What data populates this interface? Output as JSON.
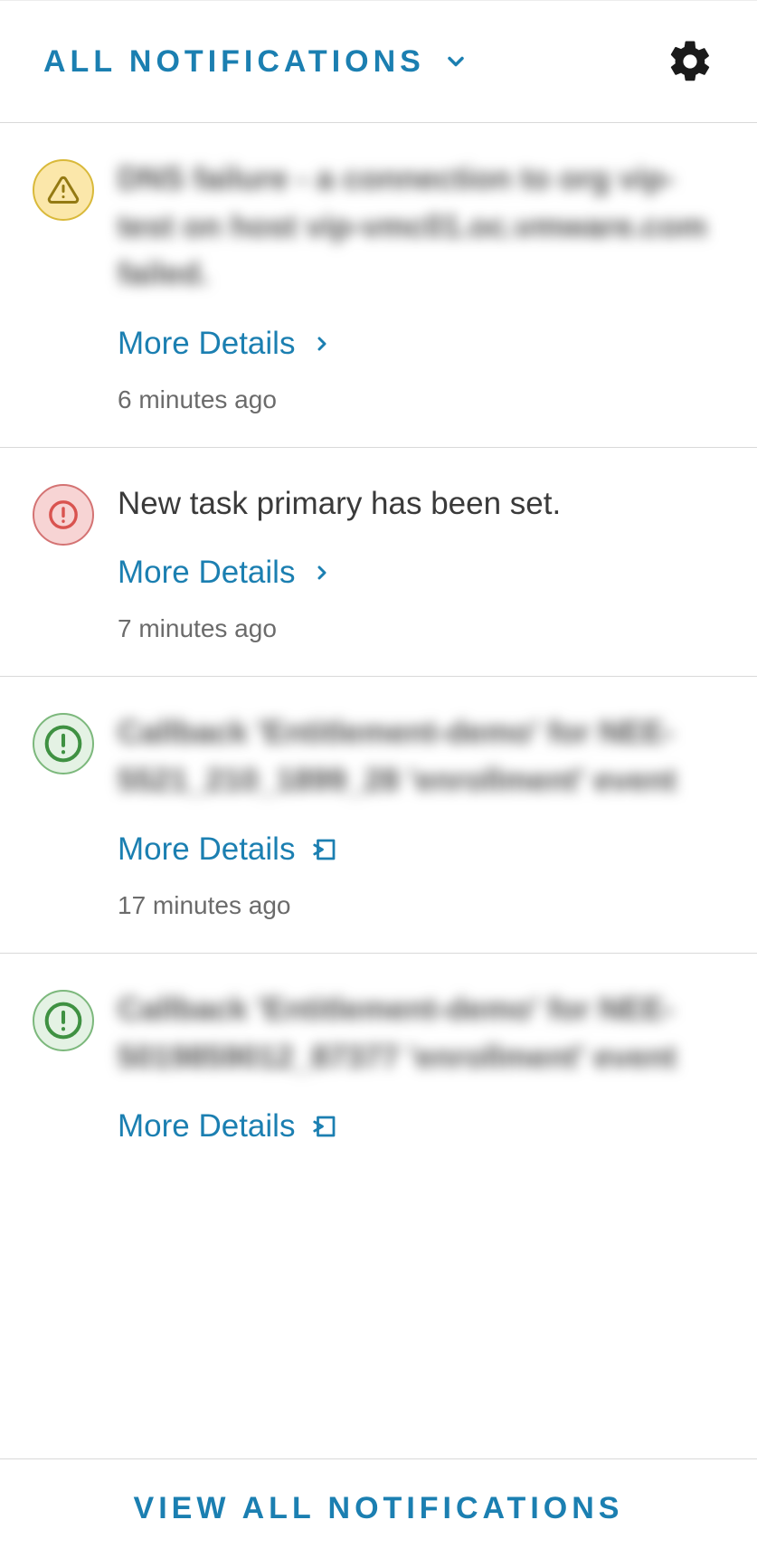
{
  "header": {
    "title": "ALL NOTIFICATIONS"
  },
  "more_details_label": "More Details",
  "footer_label": "VIEW ALL NOTIFICATIONS",
  "notifications": [
    {
      "severity": "warn",
      "icon": "warning-triangle",
      "message": "DNS failure - a connection to org vip-test on host vip-vmc01.oc.vmware.com failed.",
      "blurred": true,
      "link_style": "chevron",
      "time": "6 minutes ago"
    },
    {
      "severity": "err",
      "icon": "alert-circle",
      "message": "New task primary has been set.",
      "blurred": false,
      "link_style": "chevron",
      "time": "7 minutes ago"
    },
    {
      "severity": "ok",
      "icon": "alert-circle",
      "message": "Callback 'Entitlement-demo' for NEE-5521_210_1899_28 'enrollment' event",
      "blurred": true,
      "link_style": "external",
      "time": "17 minutes ago"
    },
    {
      "severity": "ok",
      "icon": "alert-circle",
      "message": "Callback 'Entitlement-demo' for NEE-5019859012_87377 'enrollment' event",
      "blurred": true,
      "link_style": "external",
      "time": ""
    }
  ]
}
